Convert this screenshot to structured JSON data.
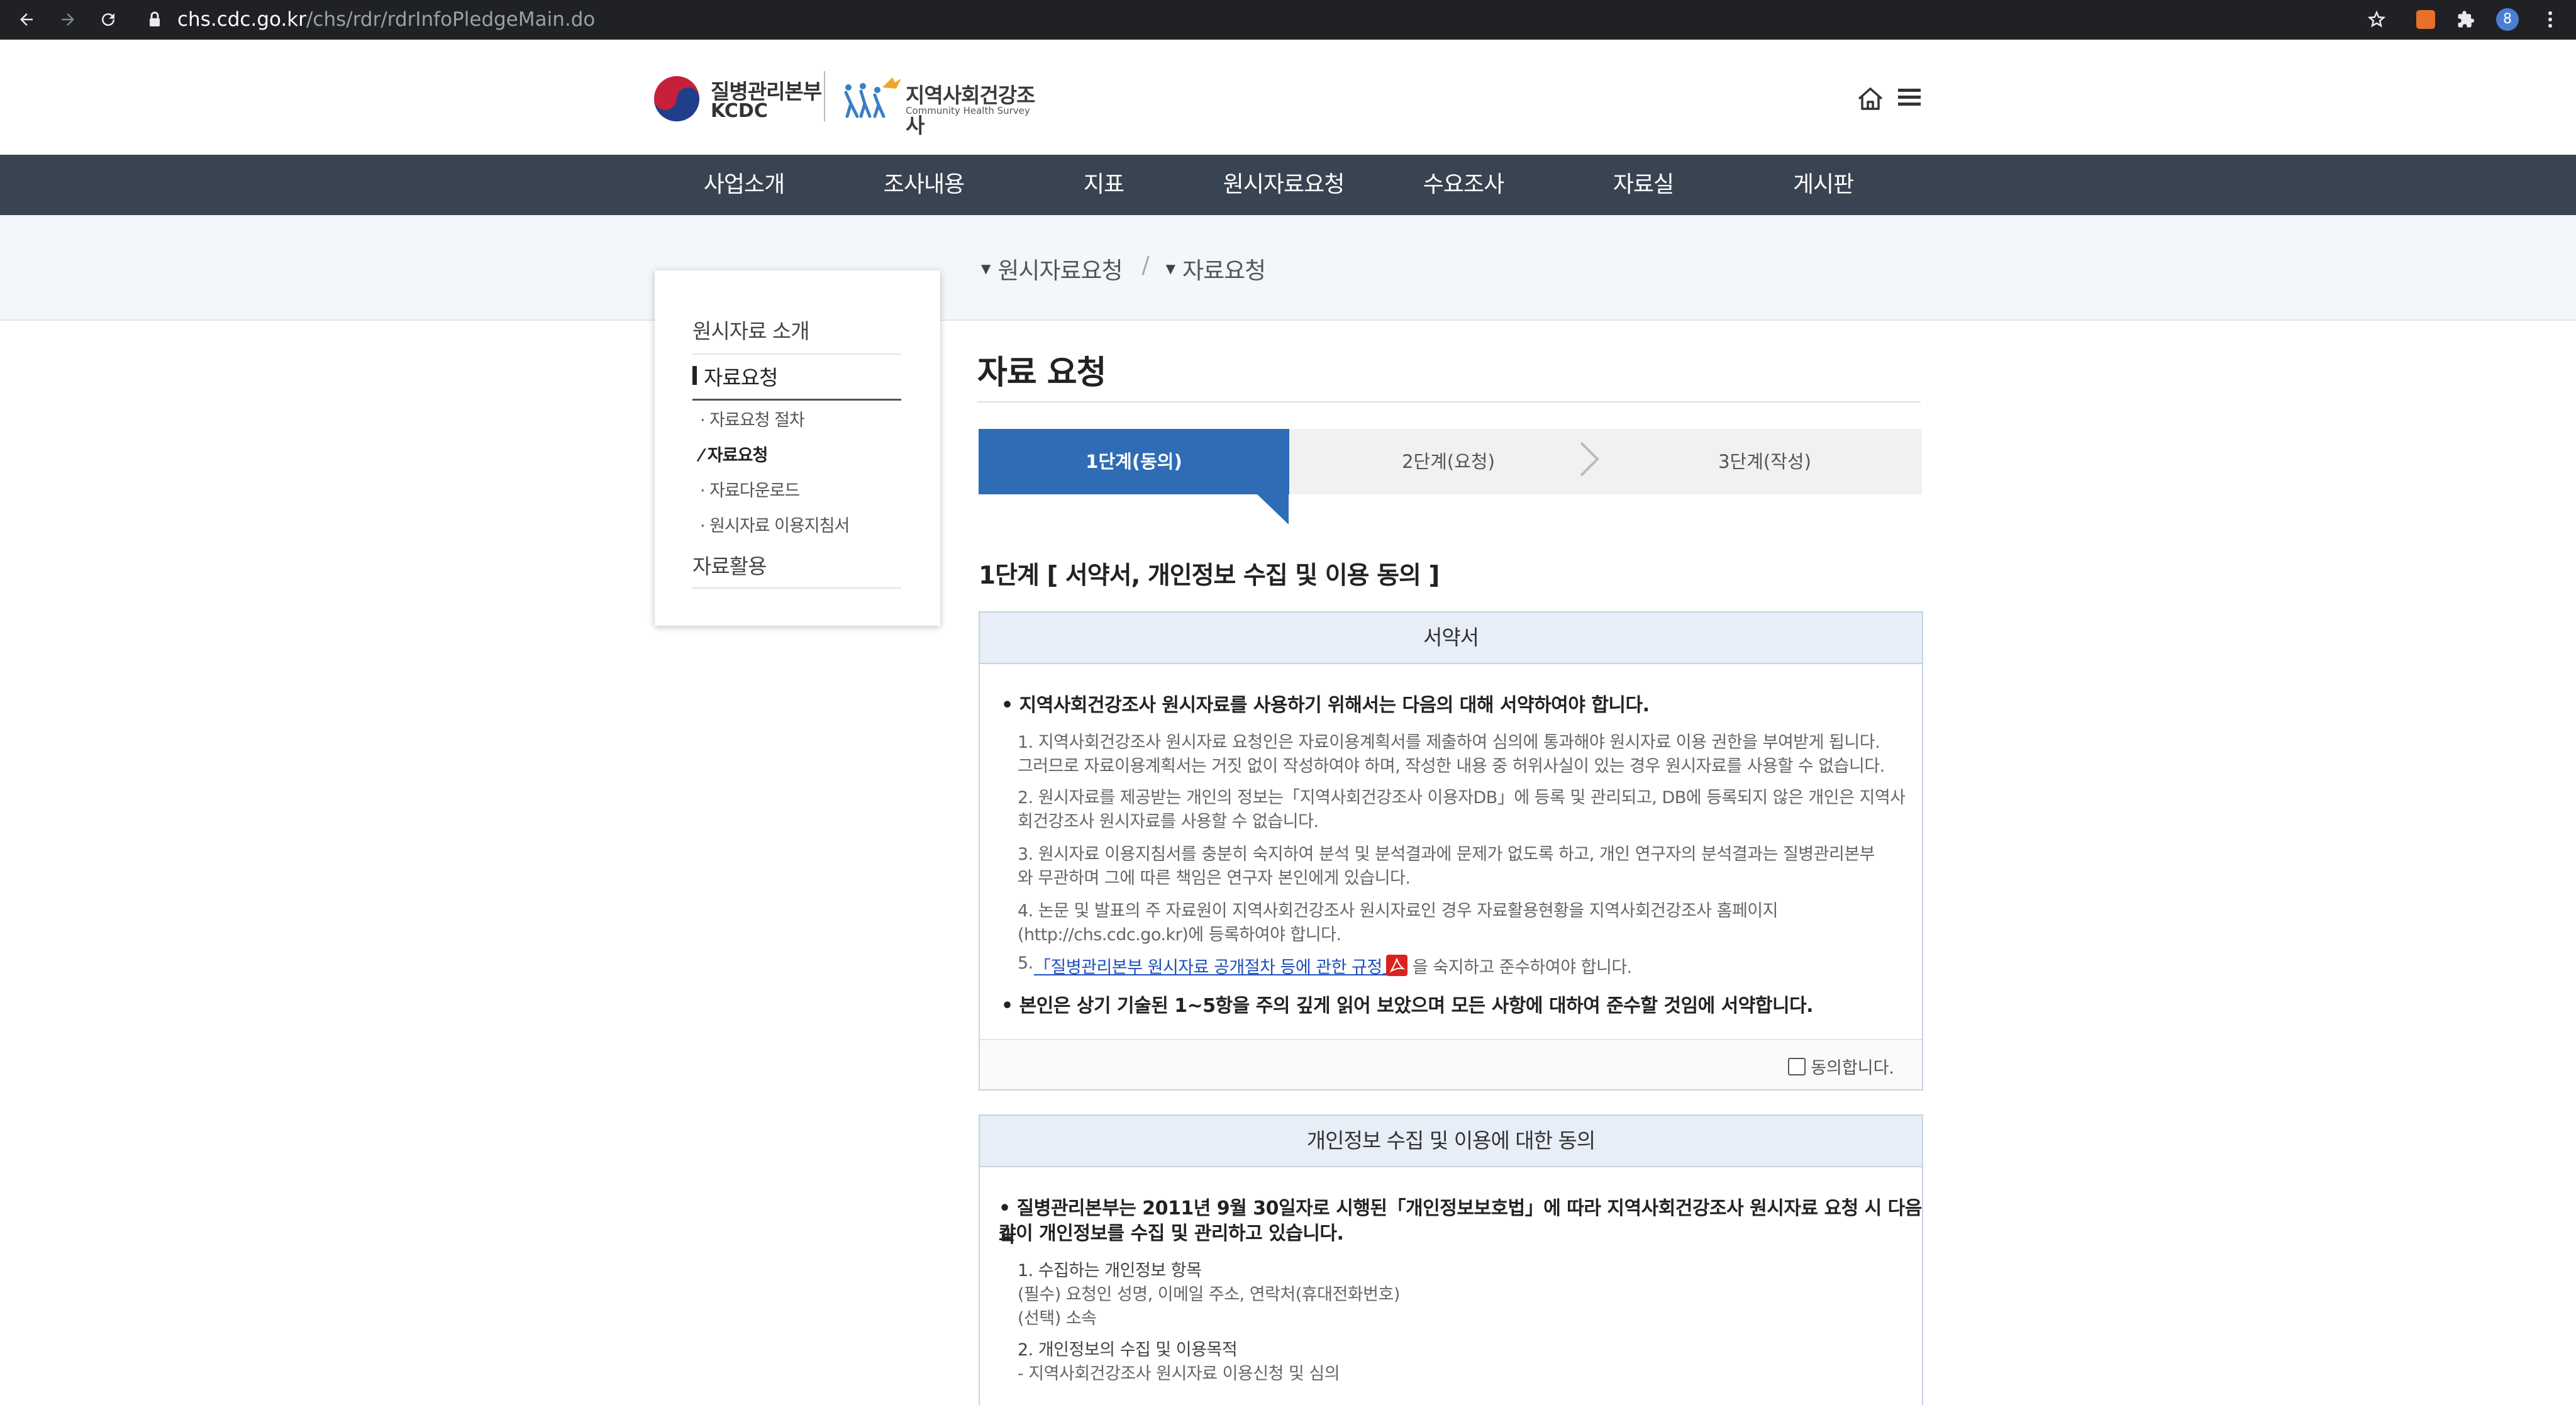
{
  "browser": {
    "url_host": "chs.cdc.go.kr",
    "url_path": "/chs/rdr/rdrInfoPledgeMain.do",
    "avatar_letter": "8"
  },
  "logo": {
    "kcdc_kr": "질병관리본부",
    "kcdc_en": "KCDC",
    "chs_kr": "지역사회건강조사",
    "chs_en": "Community Health Survey"
  },
  "nav": [
    "사업소개",
    "조사내용",
    "지표",
    "원시자료요청",
    "수요조사",
    "자료실",
    "게시판"
  ],
  "breadcrumb": [
    "원시자료요청",
    "자료요청"
  ],
  "sidebar": {
    "section1": "원시자료 소개",
    "section2": "자료요청",
    "subitems": [
      "자료요청 절차",
      "자료요청",
      "자료다운로드",
      "원시자료 이용지침서"
    ],
    "section3": "자료활용"
  },
  "page_title": "자료 요청",
  "steps": [
    "1단계(동의)",
    "2단계(요청)",
    "3단계(작성)"
  ],
  "stage_title": "1단계 [ 서약서, 개인정보 수집 및 이용 동의 ]",
  "pledge": {
    "header": "서약서",
    "intro": "• 지역사회건강조사 원시자료를 사용하기 위해서는 다음의 대해 서약하여야 합니다.",
    "lines": [
      "1. 지역사회건강조사 원시자료 요청인은 자료이용계획서를 제출하여 심의에 통과해야 원시자료 이용 권한을 부여받게 됩니다.",
      "그러므로 자료이용계획서는 거짓 없이 작성하여야 하며, 작성한 내용 중 허위사실이 있는 경우 원시자료를 사용할 수 없습니다.",
      "2. 원시자료를 제공받는 개인의 정보는「지역사회건강조사 이용자DB」에 등록 및 관리되고, DB에 등록되지 않은 개인은 지역사",
      "회건강조사 원시자료를 사용할 수 없습니다.",
      "3. 원시자료 이용지침서를 충분히 숙지하여 분석 및 분석결과에 문제가 없도록 하고, 개인 연구자의 분석결과는 질병관리본부",
      "와 무관하며 그에 따른 책임은 연구자 본인에게 있습니다.",
      "4.  논문  및  발표의  주  자료원이  지역사회건강조사  원시자료인  경우  자료활용현황을  지역사회건강조사  홈페이지",
      "(http://chs.cdc.go.kr)에 등록하여야 합니다."
    ],
    "line5_prefix": "5.",
    "line5_link": "「질병관리본부 원시자료 공개절차 등에 관한 규정」",
    "line5_suffix": "을 숙지하고 준수하여야 합니다.",
    "closing": "• 본인은 상기 기술된 1~5항을 주의 깊게 읽어 보았으며 모든 사항에 대하여 준수할 것임에 서약합니다.",
    "agree_label": "동의합니다."
  },
  "privacy": {
    "header": "개인정보 수집 및 이용에 대한 동의",
    "intro1": "• 질병관리본부는 2011년 9월 30일자로 시행된「개인정보보호법」에 따라 지역사회건강조사 원시자료 요청 시 다음과",
    "intro2": "같이 개인정보를 수집 및 관리하고 있습니다.",
    "lines": [
      "1. 수집하는 개인정보 항목",
      "(필수) 요청인 성명, 이메일 주소, 연락처(휴대전화번호)",
      "(선택) 소속",
      "2. 개인정보의 수집 및 이용목적",
      "- 지역사회건강조사 원시자료 이용신청 및 심의"
    ]
  }
}
